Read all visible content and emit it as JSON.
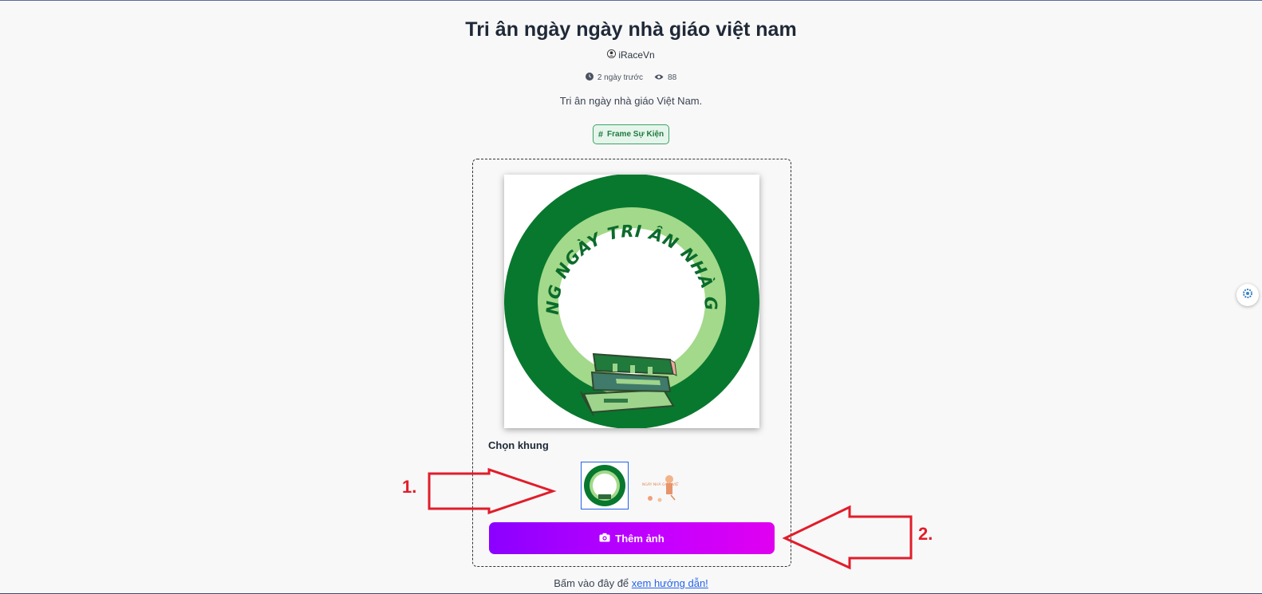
{
  "post": {
    "title": "Tri ân ngày ngày nhà giáo việt nam",
    "author": "iRaceVn",
    "time_ago": "2 ngày trước",
    "views": "88",
    "description": "Tri ân ngày nhà giáo Việt Nam.",
    "tag": "Frame Sự Kiện"
  },
  "frame": {
    "ring_text": "MỪNG NGÀY TRI ÂN NHÀ GIÁO",
    "choose_label": "Chọn khung",
    "thumb2_caption": "NGÀY NHÀ GIÁO VIỆT NAM"
  },
  "actions": {
    "add_photo": "Thêm ảnh",
    "guide_prefix": "Bấm vào đây để",
    "guide_link": "xem hướng dẫn!"
  },
  "annotations": {
    "step1": "1.",
    "step2": "2."
  },
  "colors": {
    "frame_dark_green": "#08782f",
    "frame_light_green": "#a3d98a",
    "annotation_red": "#e11d2a",
    "button_gradient_start": "#8b00ff",
    "button_gradient_end": "#e000f0"
  }
}
